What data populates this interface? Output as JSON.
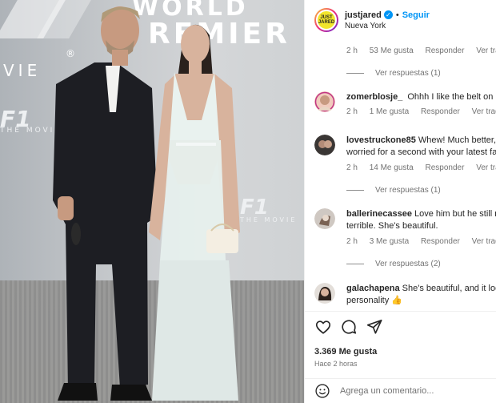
{
  "photo": {
    "backdrop_text": {
      "world": "WORLD",
      "premiere": "REMIER",
      "movie": "VIE",
      "registered": "®",
      "f1_left": "F1",
      "f1_left_sub": "THE MOVIE",
      "f1_right": "F1",
      "f1_right_sub": "THE MOVIE"
    }
  },
  "header": {
    "username": "justjared",
    "verified_mark": "✓",
    "separator": "•",
    "follow_label": "Seguir",
    "location": "Nueva York",
    "avatar_text": "JUST JARED"
  },
  "thread": {
    "top_meta": {
      "time": "2 h",
      "likes": "53 Me gusta",
      "reply": "Responder",
      "translate": "Ver traducción"
    },
    "top_replies": "Ver respuestas (1)",
    "comments": [
      {
        "user": "zomerblosje_",
        "text": "Ohhh I like the belt on Ines",
        "time": "2 h",
        "likes": "1 Me gusta",
        "reply": "Responder",
        "translate": "Ver traducción",
        "replies": ""
      },
      {
        "user": "lovestruckone85",
        "text": "Whew! Much better, I was",
        "text2": "worried for a second with your latest fa",
        "time": "2 h",
        "likes": "14 Me gusta",
        "reply": "Responder",
        "translate": "Ver traducción",
        "replies": "Ver respuestas (1)"
      },
      {
        "user": "ballerinecassee",
        "text": "Love him but he still ne",
        "text2": "terrible. She's beautiful.",
        "time": "2 h",
        "likes": "3 Me gusta",
        "reply": "Responder",
        "translate": "Ver traducción",
        "replies": "Ver respuestas (2)"
      },
      {
        "user": "galachapena",
        "text": "She's beautiful, and it loo",
        "text2": "personality 👍",
        "time": "",
        "likes": "",
        "reply": "",
        "translate": "",
        "replies": ""
      }
    ]
  },
  "actions": {
    "icons": [
      "heart-icon",
      "comment-icon",
      "share-icon"
    ],
    "likes": "3.369 Me gusta",
    "time": "Hace 2 horas"
  },
  "add_comment": {
    "placeholder": "Agrega un comentario..."
  },
  "colors": {
    "link": "#0095f6",
    "muted": "#737373",
    "text": "#262626",
    "border": "#efefef"
  }
}
